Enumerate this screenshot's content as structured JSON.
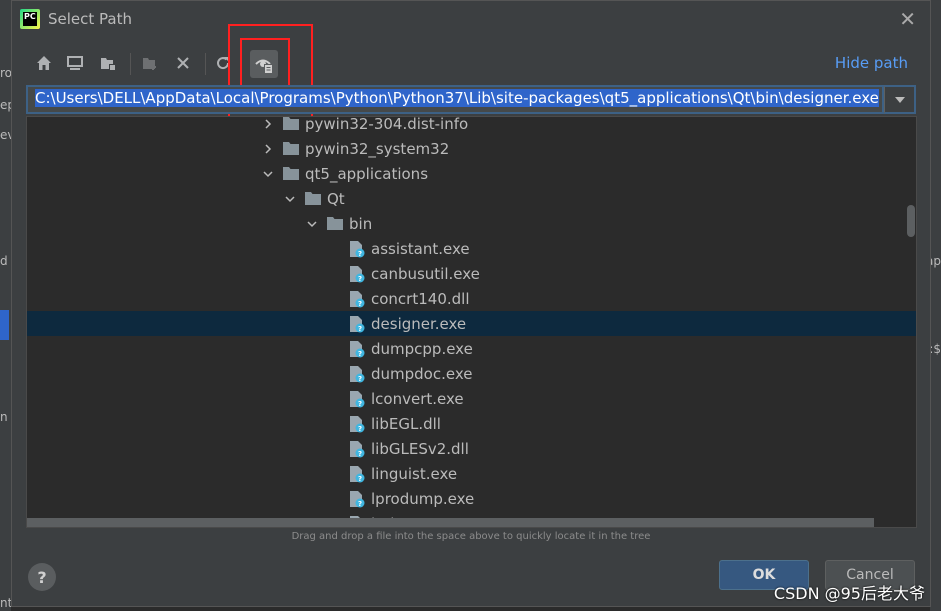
{
  "dialog": {
    "title": "Select Path",
    "app_icon_text": "PC",
    "close_icon": "close-icon"
  },
  "toolbar": {
    "buttons": [
      {
        "name": "home-directory-button",
        "icon": "home-icon"
      },
      {
        "name": "desktop-directory-button",
        "icon": "desktop-icon"
      },
      {
        "name": "project-directory-button",
        "icon": "project-folder-icon"
      },
      {
        "name": "new-folder-button",
        "icon": "new-folder-icon"
      },
      {
        "name": "delete-button",
        "icon": "delete-icon"
      },
      {
        "name": "refresh-button",
        "icon": "refresh-icon"
      },
      {
        "name": "show-hidden-files-button",
        "icon": "show-hidden-files-icon"
      }
    ],
    "hide_path_label": "Hide path"
  },
  "path_field": {
    "value": "C:\\Users\\DELL\\AppData\\Local\\Programs\\Python\\Python37\\Lib\\site-packages\\qt5_applications\\Qt\\bin\\designer.exe"
  },
  "tree": {
    "rows": [
      {
        "label": "pywin32-304.dist-info",
        "type": "folder",
        "state": "collapsed"
      },
      {
        "label": "pywin32_system32",
        "type": "folder",
        "state": "collapsed"
      },
      {
        "label": "qt5_applications",
        "type": "folder",
        "state": "expanded"
      },
      {
        "label": "Qt",
        "type": "folder",
        "state": "expanded"
      },
      {
        "label": "bin",
        "type": "folder",
        "state": "expanded"
      },
      {
        "label": "assistant.exe",
        "type": "file"
      },
      {
        "label": "canbusutil.exe",
        "type": "file"
      },
      {
        "label": "concrt140.dll",
        "type": "file"
      },
      {
        "label": "designer.exe",
        "type": "file",
        "selected": true
      },
      {
        "label": "dumpcpp.exe",
        "type": "file"
      },
      {
        "label": "dumpdoc.exe",
        "type": "file"
      },
      {
        "label": "lconvert.exe",
        "type": "file"
      },
      {
        "label": "libEGL.dll",
        "type": "file"
      },
      {
        "label": "libGLESv2.dll",
        "type": "file"
      },
      {
        "label": "linguist.exe",
        "type": "file"
      },
      {
        "label": "lprodump.exe",
        "type": "file"
      },
      {
        "label": "lrelease-pro.exe",
        "type": "file"
      }
    ]
  },
  "hint": "Drag and drop a file into the space above to quickly locate it in the tree",
  "buttons": {
    "help": "?",
    "ok": "OK",
    "cancel": "Cancel"
  },
  "watermark": "CSDN @95后老大爷",
  "colors": {
    "selection": "#0d293e",
    "accent_link": "#589df6",
    "ok_button": "#365880",
    "annotation": "#ff2020"
  }
}
